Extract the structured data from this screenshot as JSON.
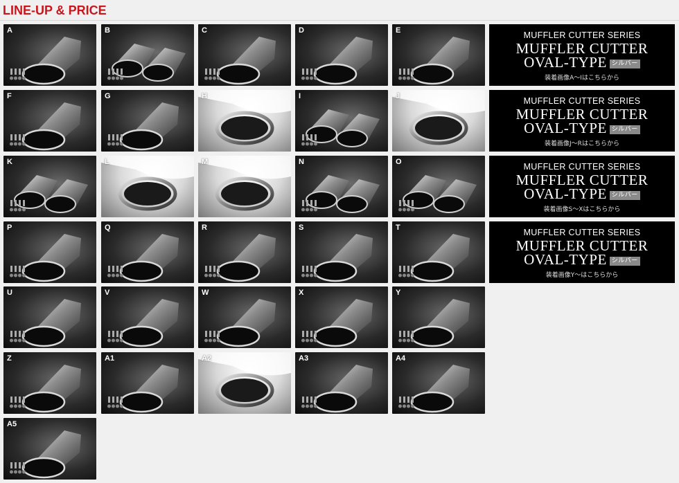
{
  "header": {
    "title": "LINE-UP & PRICE"
  },
  "tiles": [
    {
      "label": "A",
      "variant": "single-oval",
      "bg": "dark"
    },
    {
      "label": "B",
      "variant": "dual-pair",
      "bg": "dark"
    },
    {
      "label": "C",
      "variant": "single-oval",
      "bg": "dark"
    },
    {
      "label": "D",
      "variant": "single-oval",
      "bg": "dark"
    },
    {
      "label": "E",
      "variant": "single-oval",
      "bg": "dark"
    },
    {
      "label": "F",
      "variant": "single-oval",
      "bg": "dark"
    },
    {
      "label": "G",
      "variant": "single-oval",
      "bg": "dark"
    },
    {
      "label": "H",
      "variant": "installed-ring",
      "bg": "light"
    },
    {
      "label": "I",
      "variant": "dual-pair",
      "bg": "dark"
    },
    {
      "label": "J",
      "variant": "installed-ring",
      "bg": "light"
    },
    {
      "label": "K",
      "variant": "dual-pair",
      "bg": "dark"
    },
    {
      "label": "L",
      "variant": "installed-ring",
      "bg": "light"
    },
    {
      "label": "M",
      "variant": "installed-ring",
      "bg": "light"
    },
    {
      "label": "N",
      "variant": "dual-pair",
      "bg": "dark"
    },
    {
      "label": "O",
      "variant": "dual-pair",
      "bg": "dark"
    },
    {
      "label": "P",
      "variant": "single-oval",
      "bg": "dark"
    },
    {
      "label": "Q",
      "variant": "single-oval",
      "bg": "dark"
    },
    {
      "label": "R",
      "variant": "single-oval",
      "bg": "dark"
    },
    {
      "label": "S",
      "variant": "single-oval",
      "bg": "dark"
    },
    {
      "label": "T",
      "variant": "single-oval",
      "bg": "dark"
    },
    {
      "label": "U",
      "variant": "single-oval",
      "bg": "dark"
    },
    {
      "label": "V",
      "variant": "single-oval",
      "bg": "dark"
    },
    {
      "label": "W",
      "variant": "single-oval",
      "bg": "dark"
    },
    {
      "label": "X",
      "variant": "single-oval",
      "bg": "dark"
    },
    {
      "label": "Y",
      "variant": "single-oval",
      "bg": "dark"
    },
    {
      "label": "Z",
      "variant": "single-oval",
      "bg": "dark"
    },
    {
      "label": "A1",
      "variant": "single-oval",
      "bg": "dark"
    },
    {
      "label": "A2",
      "variant": "installed-ring",
      "bg": "light"
    },
    {
      "label": "A3",
      "variant": "single-oval",
      "bg": "dark"
    },
    {
      "label": "A4",
      "variant": "single-oval",
      "bg": "dark"
    },
    {
      "label": "A5",
      "variant": "single-oval",
      "bg": "dark"
    }
  ],
  "banners": [
    {
      "series": "MUFFLER CUTTER SERIES",
      "title_line1": "MUFFLER CUTTER",
      "title_line2": "OVAL-TYPE",
      "badge": "シルバー",
      "note": "装着画像A～Iはこちらから"
    },
    {
      "series": "MUFFLER CUTTER SERIES",
      "title_line1": "MUFFLER CUTTER",
      "title_line2": "OVAL-TYPE",
      "badge": "シルバー",
      "note": "装着画像J～Rはこちらから"
    },
    {
      "series": "MUFFLER CUTTER SERIES",
      "title_line1": "MUFFLER CUTTER",
      "title_line2": "OVAL-TYPE",
      "badge": "シルバー",
      "note": "装着画像S～Xはこちらから"
    },
    {
      "series": "MUFFLER CUTTER SERIES",
      "title_line1": "MUFFLER CUTTER",
      "title_line2": "OVAL-TYPE",
      "badge": "シルバー",
      "note": "装着画像Y～はこちらから"
    }
  ]
}
